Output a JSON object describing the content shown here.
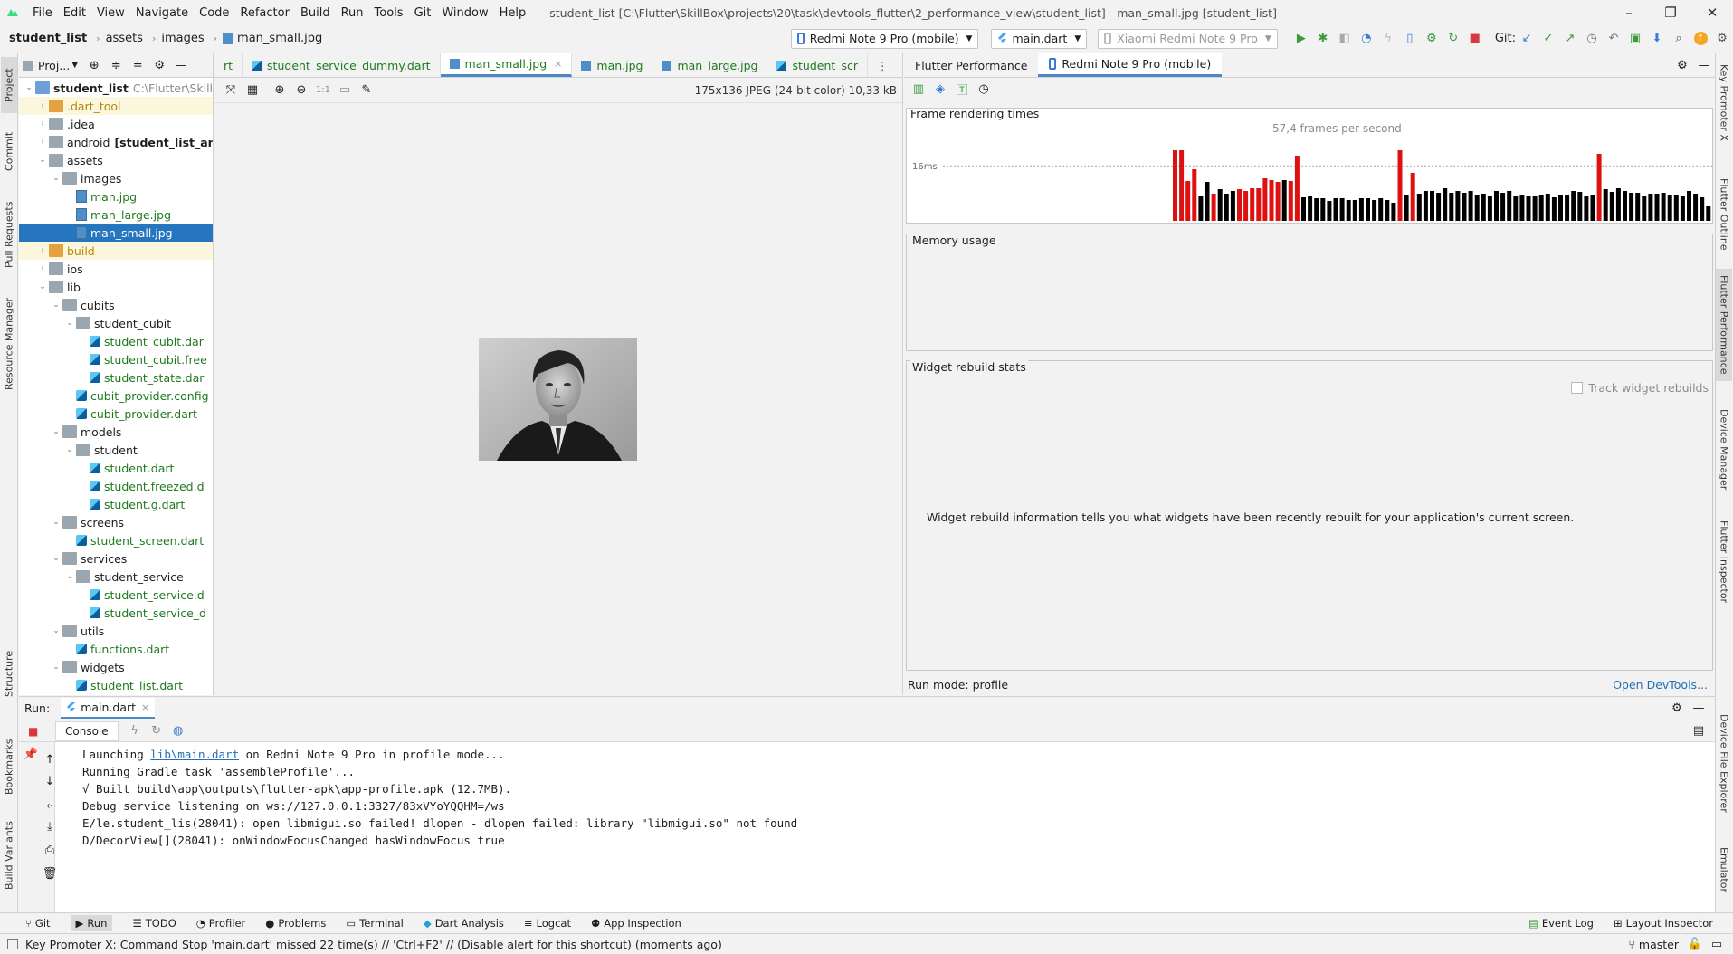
{
  "window": {
    "menu": [
      "File",
      "Edit",
      "View",
      "Navigate",
      "Code",
      "Refactor",
      "Build",
      "Run",
      "Tools",
      "Git",
      "Window",
      "Help"
    ],
    "title": "student_list [C:\\Flutter\\SkillBox\\projects\\20\\task\\devtools_flutter\\2_performance_view\\student_list] - man_small.jpg [student_list]"
  },
  "nav": {
    "breadcrumbs": [
      "student_list",
      "assets",
      "images",
      "man_small.jpg"
    ],
    "device_combo": "Redmi Note 9 Pro (mobile)",
    "run_config": "main.dart",
    "target_combo": "Xiaomi Redmi Note 9 Pro",
    "git_label": "Git:"
  },
  "project": {
    "header": "Proj...",
    "tree": [
      {
        "label": "student_list",
        "extra": "C:\\Flutter\\SkillBo",
        "depth": 0,
        "type": "root",
        "open": true,
        "bold": true
      },
      {
        "label": ".dart_tool",
        "depth": 1,
        "type": "folder-orange",
        "open": false,
        "hl": true
      },
      {
        "label": ".idea",
        "depth": 1,
        "type": "folder",
        "open": false
      },
      {
        "label": "android",
        "extra": "[student_list_and",
        "depth": 1,
        "type": "folder",
        "open": false
      },
      {
        "label": "assets",
        "depth": 1,
        "type": "folder",
        "open": true
      },
      {
        "label": "images",
        "depth": 2,
        "type": "folder",
        "open": true
      },
      {
        "label": "man.jpg",
        "depth": 3,
        "type": "image",
        "link": true
      },
      {
        "label": "man_large.jpg",
        "depth": 3,
        "type": "image",
        "link": true
      },
      {
        "label": "man_small.jpg",
        "depth": 3,
        "type": "image",
        "selected": true
      },
      {
        "label": "build",
        "depth": 1,
        "type": "folder-orange",
        "open": false,
        "hl": true
      },
      {
        "label": "ios",
        "depth": 1,
        "type": "folder",
        "open": false
      },
      {
        "label": "lib",
        "depth": 1,
        "type": "folder",
        "open": true
      },
      {
        "label": "cubits",
        "depth": 2,
        "type": "folder",
        "open": true
      },
      {
        "label": "student_cubit",
        "depth": 3,
        "type": "folder",
        "open": true
      },
      {
        "label": "student_cubit.dar",
        "depth": 4,
        "type": "dart",
        "link": true
      },
      {
        "label": "student_cubit.free",
        "depth": 4,
        "type": "dart",
        "link": true
      },
      {
        "label": "student_state.dar",
        "depth": 4,
        "type": "dart",
        "link": true
      },
      {
        "label": "cubit_provider.config",
        "depth": 3,
        "type": "dart",
        "link": true
      },
      {
        "label": "cubit_provider.dart",
        "depth": 3,
        "type": "dart",
        "link": true
      },
      {
        "label": "models",
        "depth": 2,
        "type": "folder",
        "open": true
      },
      {
        "label": "student",
        "depth": 3,
        "type": "folder",
        "open": true
      },
      {
        "label": "student.dart",
        "depth": 4,
        "type": "dart",
        "link": true
      },
      {
        "label": "student.freezed.d",
        "depth": 4,
        "type": "dart",
        "link": true
      },
      {
        "label": "student.g.dart",
        "depth": 4,
        "type": "dart",
        "link": true
      },
      {
        "label": "screens",
        "depth": 2,
        "type": "folder",
        "open": true
      },
      {
        "label": "student_screen.dart",
        "depth": 3,
        "type": "dart",
        "link": true
      },
      {
        "label": "services",
        "depth": 2,
        "type": "folder",
        "open": true
      },
      {
        "label": "student_service",
        "depth": 3,
        "type": "folder",
        "open": true
      },
      {
        "label": "student_service.d",
        "depth": 4,
        "type": "dart",
        "link": true
      },
      {
        "label": "student_service_d",
        "depth": 4,
        "type": "dart",
        "link": true
      },
      {
        "label": "utils",
        "depth": 2,
        "type": "folder",
        "open": true
      },
      {
        "label": "functions.dart",
        "depth": 3,
        "type": "dart",
        "link": true
      },
      {
        "label": "widgets",
        "depth": 2,
        "type": "folder",
        "open": true
      },
      {
        "label": "student_list.dart",
        "depth": 3,
        "type": "dart",
        "link": true
      }
    ]
  },
  "editor": {
    "tabs": [
      {
        "label": "rt",
        "icon": "none"
      },
      {
        "label": "student_service_dummy.dart",
        "icon": "dart"
      },
      {
        "label": "man_small.jpg",
        "icon": "image",
        "active": true,
        "close": "×"
      },
      {
        "label": "man.jpg",
        "icon": "image"
      },
      {
        "label": "man_large.jpg",
        "icon": "image"
      },
      {
        "label": "student_scr",
        "icon": "dart"
      }
    ],
    "image_info": "175x136 JPEG (24-bit color) 10,33 kB",
    "zoom_label": "1:1"
  },
  "perf": {
    "tabs": [
      "Flutter Performance",
      "Redmi Note 9 Pro (mobile)"
    ],
    "frame_title": "Frame rendering times",
    "fps": "57,4 frames per second",
    "threshold_label": "16ms",
    "memory_title": "Memory usage",
    "rebuild_title": "Widget rebuild stats",
    "track_label": "Track widget rebuilds",
    "rebuild_info": "Widget rebuild information tells you what widgets have been recently rebuilt for your application's current screen.",
    "run_mode": "Run mode: profile",
    "open_devtools": "Open DevTools...",
    "colors": {
      "normal": "#000000",
      "jank": "#dd1111"
    }
  },
  "chart_data": {
    "type": "bar",
    "series": [
      {
        "values": [
          78,
          78,
          44,
          57,
          28,
          43,
          30,
          35,
          30,
          33,
          35,
          33,
          36,
          36,
          47,
          45,
          43,
          45,
          44,
          72,
          26,
          28,
          25,
          25,
          22,
          25,
          25,
          23,
          23,
          25,
          25,
          23,
          25,
          23,
          20,
          78,
          29,
          53,
          30,
          33,
          33,
          31,
          36,
          31,
          33,
          31,
          33,
          29,
          30,
          28,
          33,
          31,
          33,
          28,
          29,
          28,
          28,
          29,
          30,
          26,
          29,
          29,
          33,
          32,
          28,
          29,
          74,
          35,
          32,
          36,
          33,
          31,
          31,
          28,
          30,
          30,
          31,
          29,
          29,
          28,
          33,
          30,
          26,
          16,
          20,
          20,
          18,
          20,
          16
        ],
        "jank": [
          0,
          1,
          2,
          0,
          0,
          0,
          0,
          0,
          0,
          0,
          0,
          0,
          0,
          0,
          0,
          0,
          0,
          0,
          0,
          0,
          0,
          0,
          0,
          0,
          0,
          0,
          0,
          0,
          0,
          0,
          0,
          0,
          0,
          0,
          0,
          0,
          0,
          0,
          0,
          0,
          0,
          0,
          0,
          0,
          0,
          0,
          0,
          0,
          0,
          0,
          0,
          0,
          0,
          0,
          0,
          0,
          0,
          0,
          0,
          0,
          0,
          0,
          0,
          0,
          0,
          0,
          0,
          0,
          0,
          0,
          0,
          0,
          0,
          0,
          0,
          0,
          0,
          0,
          0,
          0,
          0,
          0,
          0,
          0,
          0,
          0,
          0,
          0,
          0
        ]
      }
    ],
    "jank_indices": [
      0,
      1,
      2,
      3,
      6,
      10,
      11,
      12,
      13,
      14,
      15,
      16,
      18,
      19,
      35,
      37,
      66
    ],
    "ylabel": "",
    "threshold_ms": 16
  },
  "run": {
    "label": "Run:",
    "config": "main.dart",
    "console_tab": "Console",
    "lines": [
      {
        "pre": "Launching ",
        "link": "lib\\main.dart",
        "post": " on Redmi Note 9 Pro in profile mode..."
      },
      {
        "pre": "Running Gradle task 'assembleProfile'...",
        "link": "",
        "post": ""
      },
      {
        "pre": "√  Built build\\app\\outputs\\flutter-apk\\app-profile.apk (12.7MB).",
        "link": "",
        "post": ""
      },
      {
        "pre": "Debug service listening on ws://127.0.0.1:3327/83xVYoYQQHM=/ws",
        "link": "",
        "post": ""
      },
      {
        "pre": "E/le.student_lis(28041): open libmigui.so failed! dlopen - dlopen failed: library \"libmigui.so\" not found",
        "link": "",
        "post": ""
      },
      {
        "pre": "D/DecorView[](28041): onWindowFocusChanged hasWindowFocus true",
        "link": "",
        "post": ""
      }
    ]
  },
  "toolwindows": {
    "left": [
      "Project",
      "Commit",
      "Pull Requests",
      "Resource Manager",
      "Structure",
      "Bookmarks",
      "Build Variants"
    ],
    "right": [
      "Key Promoter X",
      "Flutter Outline",
      "Flutter Performance",
      "Device Manager",
      "Flutter Inspector",
      "Device File Explorer",
      "Emulator"
    ],
    "bottom": [
      "Git",
      "Run",
      "TODO",
      "Profiler",
      "Problems",
      "Terminal",
      "Dart Analysis",
      "Logcat",
      "App Inspection"
    ],
    "bottom_right": [
      "Event Log",
      "Layout Inspector"
    ]
  },
  "status": {
    "message": "Key Promoter X: Command Stop 'main.dart' missed 22 time(s) // 'Ctrl+F2' // (Disable alert for this shortcut) (moments ago)",
    "branch": "master"
  }
}
